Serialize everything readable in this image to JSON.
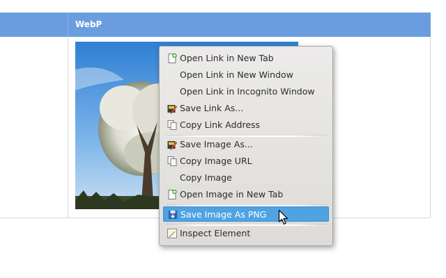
{
  "table": {
    "header": "WebP"
  },
  "menu": {
    "items": [
      {
        "label": "Open Link in New Tab",
        "icon": "page-add-icon"
      },
      {
        "label": "Open Link in New Window",
        "icon": ""
      },
      {
        "label": "Open Link in Incognito Window",
        "icon": ""
      },
      {
        "label": "Save Link As...",
        "icon": "save-as-icon"
      },
      {
        "label": "Copy Link Address",
        "icon": "copy-icon"
      },
      {
        "label": "Save Image As...",
        "icon": "save-as-icon"
      },
      {
        "label": "Copy Image URL",
        "icon": "copy-icon"
      },
      {
        "label": "Copy Image",
        "icon": ""
      },
      {
        "label": "Open Image in New Tab",
        "icon": "page-add-icon"
      },
      {
        "label": "Save Image As PNG",
        "icon": "save-png-icon"
      },
      {
        "label": "Inspect Element",
        "icon": "inspect-icon"
      }
    ]
  },
  "colors": {
    "header": "#6a9de0",
    "highlight": "#4fa3e3"
  }
}
